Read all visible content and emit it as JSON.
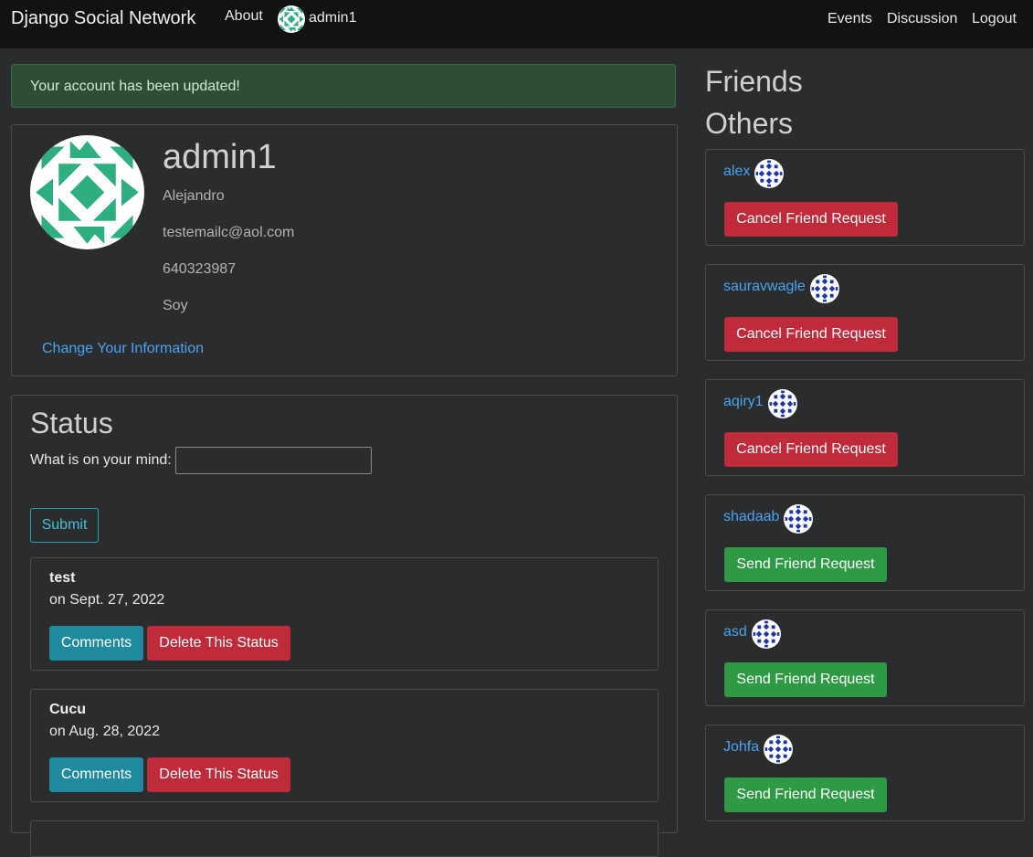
{
  "navbar": {
    "brand": "Django Social Network",
    "about": "About",
    "user": "admin1",
    "events": "Events",
    "discussion": "Discussion",
    "logout": "Logout"
  },
  "alert": {
    "message": "Your account has been updated!"
  },
  "profile": {
    "username": "admin1",
    "first_name": "Alejandro",
    "email": "testemailc@aol.com",
    "phone": "640323987",
    "bio": "Soy",
    "change_link": "Change Your Information",
    "avatar_icon": "identicon-green"
  },
  "status": {
    "title": "Status",
    "mind_label": "What is on your mind:",
    "mind_value": "",
    "submit_label": "Submit",
    "posts": [
      {
        "title": "test",
        "date": "on Sept. 27, 2022",
        "comments_label": "Comments",
        "delete_label": "Delete This Status"
      },
      {
        "title": "Cucu",
        "date": "on Aug. 28, 2022",
        "comments_label": "Comments",
        "delete_label": "Delete This Status"
      }
    ]
  },
  "sidebar": {
    "friends_title": "Friends",
    "others_title": "Others",
    "others": [
      {
        "name": "alex",
        "action": "Cancel Friend Request"
      },
      {
        "name": "sauravwagle",
        "action": "Cancel Friend Request"
      },
      {
        "name": "aqiry1",
        "action": "Cancel Friend Request"
      },
      {
        "name": "shadaab",
        "action": "Send Friend Request"
      },
      {
        "name": "asd",
        "action": "Send Friend Request"
      },
      {
        "name": "Johfa",
        "action": "Send Friend Request"
      }
    ]
  },
  "colors": {
    "accent_link": "#4aa3f0",
    "danger": "#c02b3b",
    "success": "#2f9a46",
    "info": "#1f8a9e",
    "identicon_green": "#2fae80",
    "identicon_blue": "#1e33a8"
  }
}
